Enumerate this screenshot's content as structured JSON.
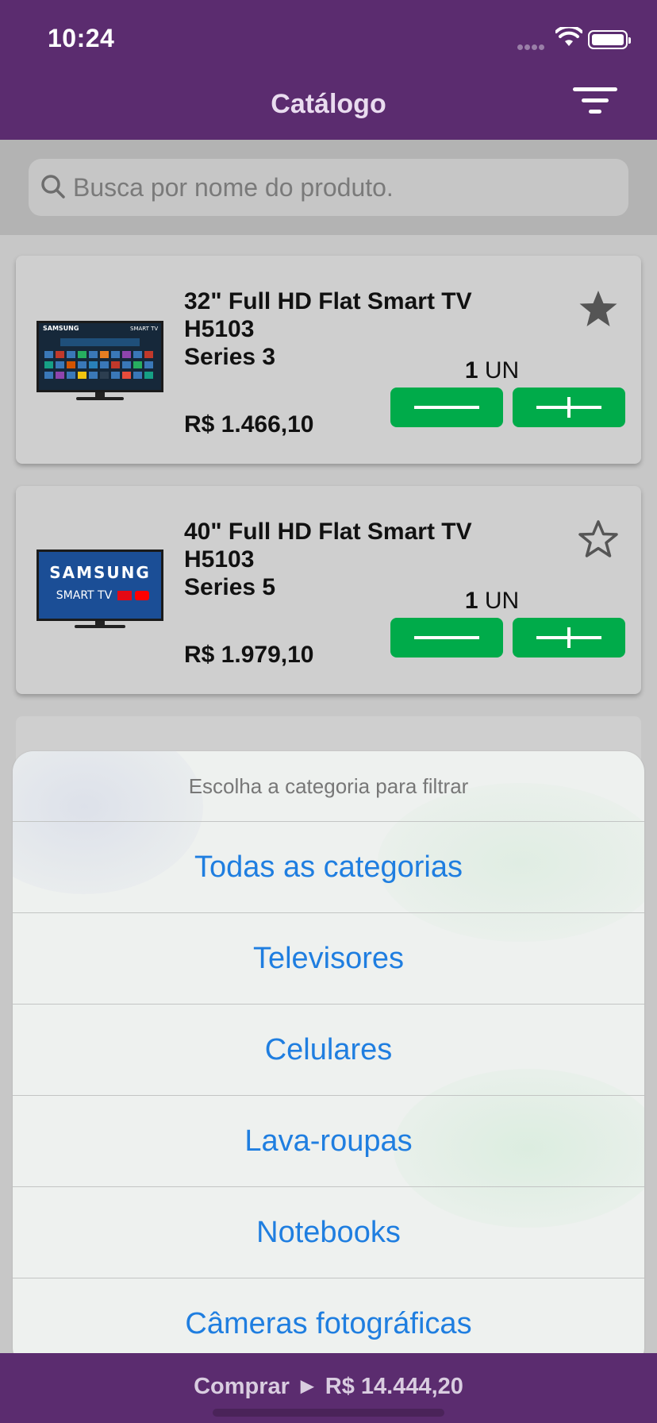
{
  "status_bar": {
    "time": "10:24"
  },
  "nav": {
    "title": "Catálogo",
    "filter_icon": "filter-icon"
  },
  "search": {
    "placeholder": "Busca por nome do produto.",
    "icon": "search-icon"
  },
  "products": [
    {
      "name_line1": "32\" Full HD Flat Smart TV H5103",
      "name_line2": "Series 3",
      "favorite": true,
      "qty_value": "1",
      "qty_unit": "UN",
      "price": "R$ 1.466,10",
      "image_brand": "SAMSUNG",
      "image_label": "SMART TV"
    },
    {
      "name_line1": "40\" Full HD Flat Smart TV H5103",
      "name_line2": "Series 5",
      "favorite": false,
      "qty_value": "1",
      "qty_unit": "UN",
      "price": "R$ 1.979,10",
      "image_brand": "SAMSUNG",
      "image_label": "SMART TV"
    }
  ],
  "action_sheet": {
    "title": "Escolha a categoria para filtrar",
    "options": [
      "Todas as categorias",
      "Televisores",
      "Celulares",
      "Lava-roupas",
      "Notebooks",
      "Câmeras fotográficas"
    ]
  },
  "bottom_bar": {
    "buy_label": "Comprar ► R$ 14.444,20"
  },
  "colors": {
    "primary": "#5b2c6f",
    "accent_green": "#00ab4a",
    "link_blue": "#1f7ee0"
  }
}
